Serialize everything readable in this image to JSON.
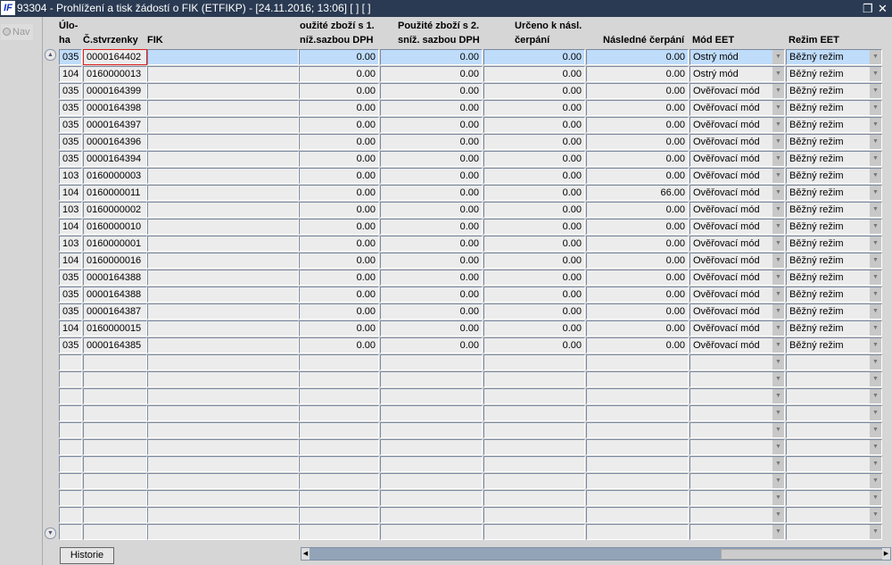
{
  "window": {
    "title": "93304 - Prohlížení a tisk žádostí o FIK (ETFIKP) - [24.11.2016; 13:06]  [ ]  [ ]",
    "logo": "IF",
    "restore_icon": "restore-icon",
    "close_icon": "close-icon"
  },
  "nav": {
    "label": "Nav"
  },
  "headers": {
    "uloha": "Úlo-\nha",
    "stvrzenky": "Č.stvrzenky",
    "fik": "FIK",
    "zbozi1": "oužité zboží s 1.\nníž.sazbou DPH",
    "zbozi2": "Použité zboží s 2.\nsníž. sazbou DPH",
    "urceno": "Určeno k násl.\nčerpání",
    "nasledne": "Následné čerpání",
    "mod": "Mód EET",
    "rezim": "Režim EET"
  },
  "rows": [
    {
      "uloha": "035",
      "stvrzenka": "0000164402",
      "fik": "",
      "z1": "0.00",
      "z2": "0.00",
      "urceno": "0.00",
      "nasledne": "0.00",
      "mod": "Ostrý mód",
      "rezim": "Běžný režim"
    },
    {
      "uloha": "104",
      "stvrzenka": "0160000013",
      "fik": "",
      "z1": "0.00",
      "z2": "0.00",
      "urceno": "0.00",
      "nasledne": "0.00",
      "mod": "Ostrý mód",
      "rezim": "Běžný režim"
    },
    {
      "uloha": "035",
      "stvrzenka": "0000164399",
      "fik": "",
      "z1": "0.00",
      "z2": "0.00",
      "urceno": "0.00",
      "nasledne": "0.00",
      "mod": "Ověřovací mód",
      "rezim": "Běžný režim"
    },
    {
      "uloha": "035",
      "stvrzenka": "0000164398",
      "fik": "",
      "z1": "0.00",
      "z2": "0.00",
      "urceno": "0.00",
      "nasledne": "0.00",
      "mod": "Ověřovací mód",
      "rezim": "Běžný režim"
    },
    {
      "uloha": "035",
      "stvrzenka": "0000164397",
      "fik": "",
      "z1": "0.00",
      "z2": "0.00",
      "urceno": "0.00",
      "nasledne": "0.00",
      "mod": "Ověřovací mód",
      "rezim": "Běžný režim"
    },
    {
      "uloha": "035",
      "stvrzenka": "0000164396",
      "fik": "",
      "z1": "0.00",
      "z2": "0.00",
      "urceno": "0.00",
      "nasledne": "0.00",
      "mod": "Ověřovací mód",
      "rezim": "Běžný režim"
    },
    {
      "uloha": "035",
      "stvrzenka": "0000164394",
      "fik": "",
      "z1": "0.00",
      "z2": "0.00",
      "urceno": "0.00",
      "nasledne": "0.00",
      "mod": "Ověřovací mód",
      "rezim": "Běžný režim"
    },
    {
      "uloha": "103",
      "stvrzenka": "0160000003",
      "fik": "",
      "z1": "0.00",
      "z2": "0.00",
      "urceno": "0.00",
      "nasledne": "0.00",
      "mod": "Ověřovací mód",
      "rezim": "Běžný režim"
    },
    {
      "uloha": "104",
      "stvrzenka": "0160000011",
      "fik": "",
      "z1": "0.00",
      "z2": "0.00",
      "urceno": "0.00",
      "nasledne": "66.00",
      "mod": "Ověřovací mód",
      "rezim": "Běžný režim"
    },
    {
      "uloha": "103",
      "stvrzenka": "0160000002",
      "fik": "",
      "z1": "0.00",
      "z2": "0.00",
      "urceno": "0.00",
      "nasledne": "0.00",
      "mod": "Ověřovací mód",
      "rezim": "Běžný režim"
    },
    {
      "uloha": "104",
      "stvrzenka": "0160000010",
      "fik": "",
      "z1": "0.00",
      "z2": "0.00",
      "urceno": "0.00",
      "nasledne": "0.00",
      "mod": "Ověřovací mód",
      "rezim": "Běžný režim"
    },
    {
      "uloha": "103",
      "stvrzenka": "0160000001",
      "fik": "",
      "z1": "0.00",
      "z2": "0.00",
      "urceno": "0.00",
      "nasledne": "0.00",
      "mod": "Ověřovací mód",
      "rezim": "Běžný režim"
    },
    {
      "uloha": "104",
      "stvrzenka": "0160000016",
      "fik": "",
      "z1": "0.00",
      "z2": "0.00",
      "urceno": "0.00",
      "nasledne": "0.00",
      "mod": "Ověřovací mód",
      "rezim": "Běžný režim"
    },
    {
      "uloha": "035",
      "stvrzenka": "0000164388",
      "fik": "",
      "z1": "0.00",
      "z2": "0.00",
      "urceno": "0.00",
      "nasledne": "0.00",
      "mod": "Ověřovací mód",
      "rezim": "Běžný režim"
    },
    {
      "uloha": "035",
      "stvrzenka": "0000164388",
      "fik": "",
      "z1": "0.00",
      "z2": "0.00",
      "urceno": "0.00",
      "nasledne": "0.00",
      "mod": "Ověřovací mód",
      "rezim": "Běžný režim"
    },
    {
      "uloha": "035",
      "stvrzenka": "0000164387",
      "fik": "",
      "z1": "0.00",
      "z2": "0.00",
      "urceno": "0.00",
      "nasledne": "0.00",
      "mod": "Ověřovací mód",
      "rezim": "Běžný režim"
    },
    {
      "uloha": "104",
      "stvrzenka": "0160000015",
      "fik": "",
      "z1": "0.00",
      "z2": "0.00",
      "urceno": "0.00",
      "nasledne": "0.00",
      "mod": "Ověřovací mód",
      "rezim": "Běžný režim"
    },
    {
      "uloha": "035",
      "stvrzenka": "0000164385",
      "fik": "",
      "z1": "0.00",
      "z2": "0.00",
      "urceno": "0.00",
      "nasledne": "0.00",
      "mod": "Ověřovací mód",
      "rezim": "Běžný režim"
    }
  ],
  "empty_rows": 11,
  "buttons": {
    "historie": "Historie"
  }
}
